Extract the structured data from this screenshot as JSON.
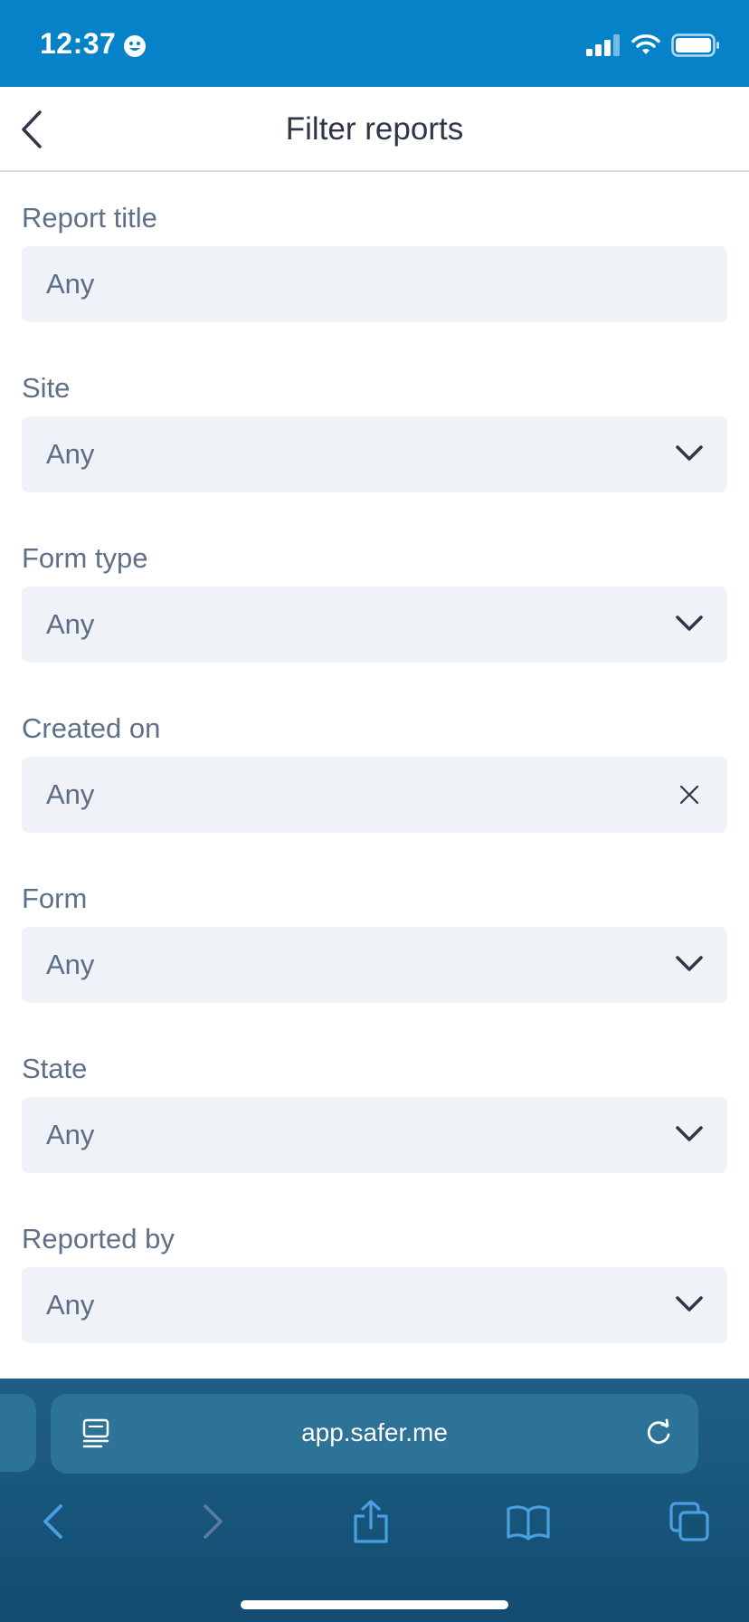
{
  "status_bar": {
    "time": "12:37",
    "icons": [
      "smiley-icon",
      "cellular-signal-icon",
      "wifi-icon",
      "battery-icon"
    ]
  },
  "header": {
    "title": "Filter reports",
    "back_icon": "chevron-left-icon"
  },
  "filters": [
    {
      "label": "Report title",
      "value": "Any",
      "control": "text"
    },
    {
      "label": "Site",
      "value": "Any",
      "control": "select"
    },
    {
      "label": "Form type",
      "value": "Any",
      "control": "select"
    },
    {
      "label": "Created on",
      "value": "Any",
      "control": "clearable"
    },
    {
      "label": "Form",
      "value": "Any",
      "control": "select"
    },
    {
      "label": "State",
      "value": "Any",
      "control": "select"
    },
    {
      "label": "Reported by",
      "value": "Any",
      "control": "select"
    }
  ],
  "browser": {
    "url": "app.safer.me",
    "toolbar_icons": [
      "back-icon",
      "forward-icon",
      "share-icon",
      "bookmarks-icon",
      "tabs-icon"
    ]
  },
  "colors": {
    "status_bar": "#0582c8",
    "field_background": "#eff2f7",
    "label_text": "#5f7089",
    "browser_chrome": "#124c70",
    "browser_accent": "#4a9fe0"
  }
}
